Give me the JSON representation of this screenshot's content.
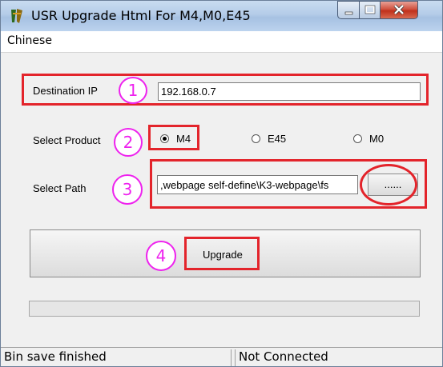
{
  "window": {
    "title": "USR Upgrade Html For M4,M0,E45",
    "icons": {
      "app": "app-icon",
      "minimize": "minimize-icon",
      "maximize": "maximize-icon",
      "close": "close-icon"
    }
  },
  "menu": {
    "items": [
      {
        "label": "Chinese"
      }
    ]
  },
  "form": {
    "destination_ip_label": "Destination IP",
    "destination_ip_value": "192.168.0.7",
    "select_product_label": "Select Product",
    "products": [
      {
        "label": "M4",
        "selected": true
      },
      {
        "label": "E45",
        "selected": false
      },
      {
        "label": "M0",
        "selected": false
      }
    ],
    "select_path_label": "Select Path",
    "path_value": ",webpage self-define\\K3-webpage\\fs",
    "browse_label": "......",
    "upgrade_label": "Upgrade",
    "progress": 0
  },
  "annotations": {
    "step_numbers": [
      "1",
      "2",
      "3",
      "4"
    ],
    "box_color": "#e3242b",
    "circle_color": "#ee22ee"
  },
  "status": {
    "left": "Bin save finished",
    "right": "Not Connected"
  }
}
